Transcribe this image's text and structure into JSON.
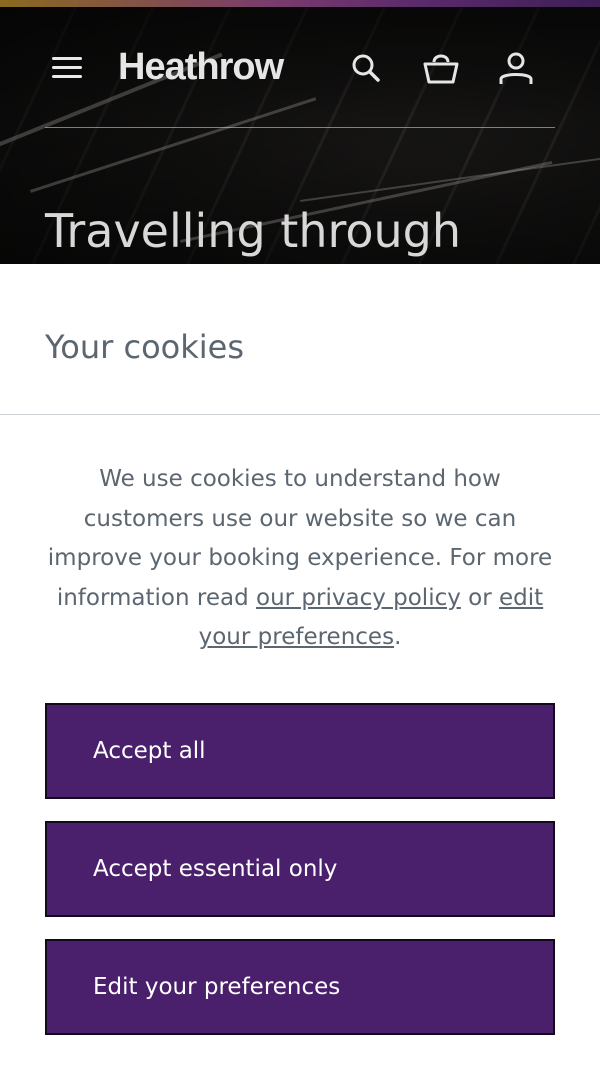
{
  "header": {
    "logo_text": "Heathrow",
    "hero_title": "Travelling through",
    "icons": [
      "menu-icon",
      "search-icon",
      "basket-icon",
      "account-icon"
    ]
  },
  "cookie_banner": {
    "title": "Your cookies",
    "body_before": "We use cookies to understand how customers use our website so we can improve your booking experience. For more information read ",
    "privacy_link": "our privacy policy",
    "body_middle": " or ",
    "preferences_link": "edit your preferences",
    "body_after": ".",
    "buttons": {
      "accept_all": "Accept all",
      "accept_essential": "Accept essential only",
      "edit_preferences": "Edit your preferences"
    }
  },
  "colors": {
    "button_purple": "#4a206d",
    "text_grey": "#5c6670",
    "divider": "#cfd4d8"
  }
}
